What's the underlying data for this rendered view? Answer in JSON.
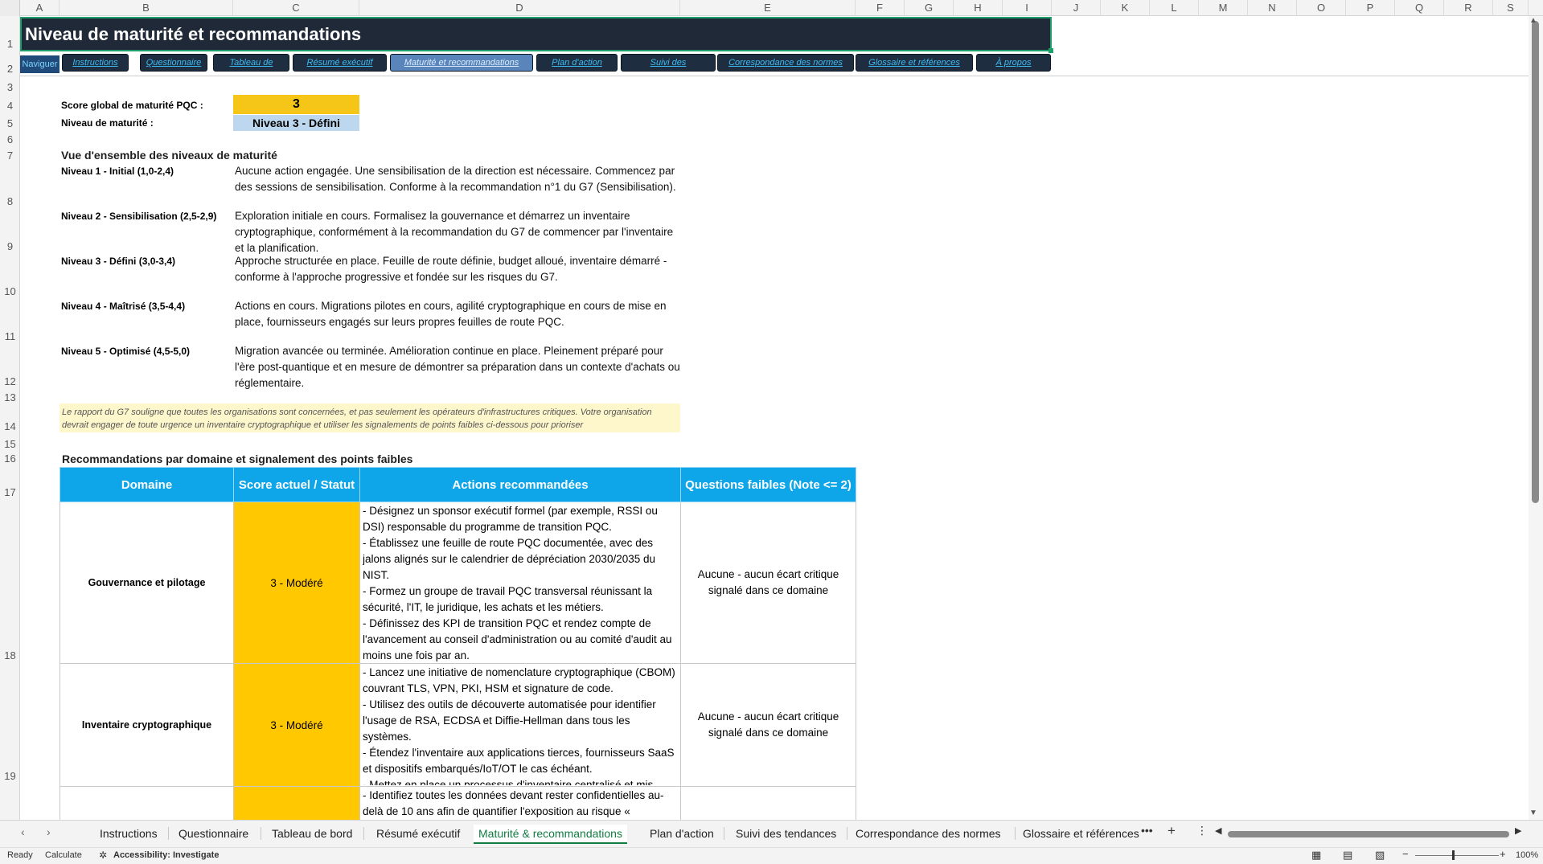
{
  "columns": [
    "A",
    "B",
    "C",
    "D",
    "E",
    "F",
    "G",
    "H",
    "I",
    "J",
    "K",
    "L",
    "M",
    "N",
    "O",
    "P",
    "Q",
    "R",
    "S"
  ],
  "rows": [
    "1",
    "2",
    "3",
    "4",
    "5",
    "6",
    "7",
    "8",
    "9",
    "10",
    "11",
    "12",
    "13",
    "14",
    "15",
    "16",
    "17",
    "18",
    "19"
  ],
  "title": "Niveau de maturité et recommandations",
  "nav": {
    "label": "Naviguer",
    "buttons": [
      "Instructions",
      "Questionnaire",
      "Tableau de",
      "Résumé exécutif",
      "Maturité et recommandations",
      "Plan d'action",
      "Suivi des",
      "Correspondance des normes",
      "Glossaire et références",
      "À propos"
    ]
  },
  "score": {
    "label": "Score global de maturité PQC :",
    "value": "3",
    "level_label": "Niveau de maturité :",
    "level_value": "Niveau 3 - Défini"
  },
  "overview": {
    "heading": "Vue d'ensemble des niveaux de maturité",
    "levels": [
      {
        "name": "Niveau 1 - Initial (1,0-2,4)",
        "desc": "Aucune action engagée. Une sensibilisation de la direction est nécessaire. Commencez par des sessions de sensibilisation. Conforme à la recommandation n°1 du G7 (Sensibilisation)."
      },
      {
        "name": "Niveau 2 - Sensibilisation (2,5-2,9)",
        "desc": "Exploration initiale en cours. Formalisez la gouvernance et démarrez un inventaire cryptographique, conformément à la recommandation du G7 de commencer par l'inventaire et la planification."
      },
      {
        "name": "Niveau 3 - Défini (3,0-3,4)",
        "desc": "Approche structurée en place. Feuille de route définie, budget alloué, inventaire démarré - conforme à l'approche progressive et fondée sur les risques du G7."
      },
      {
        "name": "Niveau 4 - Maîtrisé (3,5-4,4)",
        "desc": "Actions en cours. Migrations pilotes en cours, agilité cryptographique en cours de mise en place, fournisseurs engagés sur leurs propres feuilles de route PQC."
      },
      {
        "name": "Niveau 5 - Optimisé (4,5-5,0)",
        "desc": "Migration avancée ou terminée. Amélioration continue en place. Pleinement préparé pour l'ère post-quantique et en mesure de démontrer sa préparation dans un contexte d'achats ou réglementaire."
      }
    ]
  },
  "note": "Le rapport du G7 souligne que toutes les organisations sont concernées, et pas seulement les opérateurs d'infrastructures critiques. Votre organisation devrait engager de toute urgence un inventaire cryptographique et utiliser les signalements de points faibles ci-dessous pour prioriser",
  "recommendations": {
    "heading": "Recommandations par domaine et signalement des points faibles",
    "headers": [
      "Domaine",
      "Score actuel / Statut",
      "Actions recommandées",
      "Questions faibles (Note <= 2)"
    ],
    "rows": [
      {
        "domain": "Gouvernance et pilotage",
        "status": "3 - Modéré",
        "actions": [
          "- Désignez un sponsor exécutif formel (par exemple, RSSI ou DSI) responsable du programme de transition PQC.",
          "- Établissez une feuille de route PQC documentée, avec des jalons alignés sur le calendrier de dépréciation 2030/2035 du NIST.",
          "- Formez un groupe de travail PQC transversal réunissant la sécurité, l'IT, le juridique, les achats et les métiers.",
          "- Définissez des KPI de transition PQC et rendez compte de l'avancement au conseil d'administration ou au comité d'audit au moins une fois par an."
        ],
        "weak": "Aucune - aucun écart critique signalé dans ce domaine"
      },
      {
        "domain": "Inventaire cryptographique",
        "status": "3 - Modéré",
        "actions": [
          "- Lancez une initiative de nomenclature cryptographique (CBOM) couvrant TLS, VPN, PKI, HSM et signature de code.",
          "- Utilisez des outils de découverte automatisée pour identifier l'usage de RSA, ECDSA et Diffie-Hellman dans tous les systèmes.",
          "- Étendez l'inventaire aux applications tierces, fournisseurs SaaS et dispositifs embarqués/IoT/OT le cas échéant.",
          "- Mettez en place un processus d'inventaire centralisé et mis"
        ],
        "weak": "Aucune - aucun écart critique signalé dans ce domaine"
      },
      {
        "domain": "",
        "status": "",
        "actions": [
          "- Identifiez toutes les données devant rester confidentielles au-delà de 10 ans afin de quantifier l'exposition au risque «"
        ],
        "weak": ""
      }
    ]
  },
  "sheet_tabs": [
    "Instructions",
    "Questionnaire",
    "Tableau de bord",
    "Résumé exécutif",
    "Maturité & recommandations",
    "Plan d'action",
    "Suivi des tendances",
    "Correspondance des normes",
    "Glossaire et références"
  ],
  "active_tab": "Maturité & recommandations",
  "status": {
    "ready": "Ready",
    "calculate": "Calculate",
    "accessibility": "Accessibility: Investigate",
    "zoom": "100%"
  }
}
